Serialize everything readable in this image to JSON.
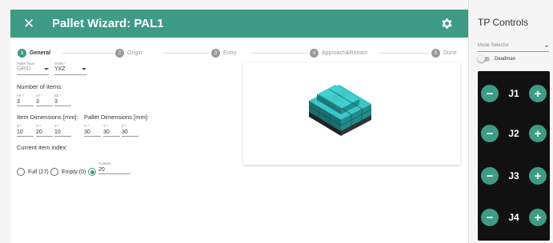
{
  "wizard": {
    "title": "Pallet Wizard: PAL1",
    "steps": [
      {
        "num": "1",
        "label": "General"
      },
      {
        "num": "2",
        "label": "Origin"
      },
      {
        "num": "3",
        "label": "Entry"
      },
      {
        "num": "4",
        "label": "Approach&Retract"
      },
      {
        "num": "5",
        "label": "Done"
      }
    ]
  },
  "form": {
    "pallet_type_label": "Pallet Type",
    "pallet_type_value": "GRID",
    "order_label": "Order *",
    "order_value": "YXZ",
    "number_of_items_label": "Number of items:",
    "nx_label": "nX *",
    "nx_value": "3",
    "ny_label": "nY *",
    "ny_value": "3",
    "nz_label": "nZ *",
    "nz_value": "3",
    "item_dims_label": "Item Dimensions [mm]:",
    "item_x_label": "X *",
    "item_x_value": "10",
    "item_y_label": "Y *",
    "item_y_value": "20",
    "item_z_label": "Z *",
    "item_z_value": "10",
    "pallet_dims_label": "Pallet Dimensions [mm]:",
    "pallet_x_label": "X *",
    "pallet_x_value": "30",
    "pallet_y_label": "Y *",
    "pallet_y_value": "30",
    "pallet_z_label": "Z *",
    "pallet_z_value": "30",
    "current_index_label": "Current item index:",
    "radio_full": "Full (27)",
    "radio_empty": "Empty (0)",
    "custom_label": "Custom",
    "custom_value": "20"
  },
  "tp": {
    "title": "TP Controls",
    "mode_selector_placeholder": "Mode Selector",
    "deadman_label": "Deadman",
    "joints": [
      {
        "label": "J1",
        "minus": "−",
        "plus": "+"
      },
      {
        "label": "J2",
        "minus": "−",
        "plus": "+"
      },
      {
        "label": "J3",
        "minus": "−",
        "plus": "+"
      },
      {
        "label": "J4",
        "minus": "−",
        "plus": "+"
      }
    ]
  },
  "colors": {
    "accent": "#3d9b86",
    "pallet_top": "#3cc6c6",
    "pallet_side": "#1f8a8a",
    "base": "#333333"
  },
  "icons": {
    "close": "close-icon",
    "settings": "gear-icon"
  }
}
